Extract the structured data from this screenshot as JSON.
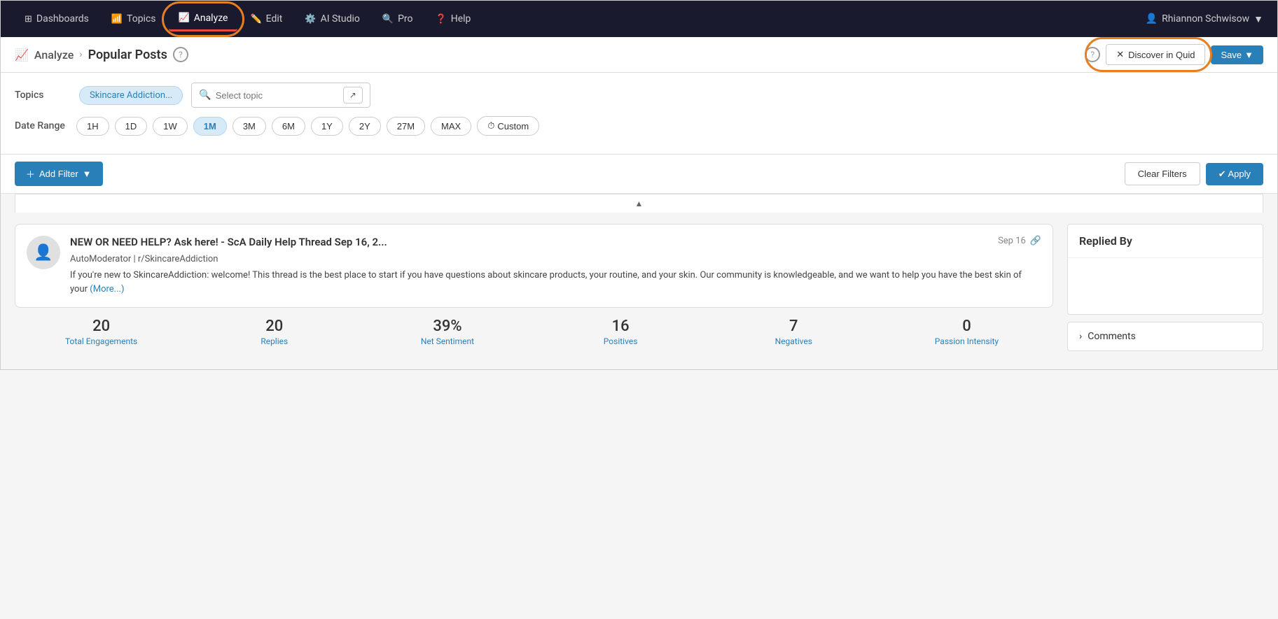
{
  "nav": {
    "items": [
      {
        "id": "dashboards",
        "label": "Dashboards",
        "icon": "⊞",
        "active": false
      },
      {
        "id": "topics",
        "label": "Topics",
        "icon": "📶",
        "active": false
      },
      {
        "id": "analyze",
        "label": "Analyze",
        "icon": "📈",
        "active": true
      },
      {
        "id": "edit",
        "label": "Edit",
        "icon": "✏️",
        "active": false
      },
      {
        "id": "ai-studio",
        "label": "AI Studio",
        "icon": "⚙️",
        "active": false
      },
      {
        "id": "pro",
        "label": "Pro",
        "icon": "🔍",
        "active": false
      },
      {
        "id": "help",
        "label": "Help",
        "icon": "❓",
        "active": false
      }
    ],
    "user": "Rhiannon Schwisow"
  },
  "subheader": {
    "breadcrumb_icon": "📈",
    "breadcrumb_parent": "Analyze",
    "breadcrumb_current": "Popular Posts",
    "discover_btn_label": "Discover in Quid",
    "save_btn_label": "Save"
  },
  "filters": {
    "topics_label": "Topics",
    "topic_chip": "Skincare Addiction...",
    "topic_search_placeholder": "Select topic",
    "date_range_label": "Date Range",
    "date_buttons": [
      {
        "id": "1h",
        "label": "1H",
        "active": false
      },
      {
        "id": "1d",
        "label": "1D",
        "active": false
      },
      {
        "id": "1w",
        "label": "1W",
        "active": false
      },
      {
        "id": "1m",
        "label": "1M",
        "active": true
      },
      {
        "id": "3m",
        "label": "3M",
        "active": false
      },
      {
        "id": "6m",
        "label": "6M",
        "active": false
      },
      {
        "id": "1y",
        "label": "1Y",
        "active": false
      },
      {
        "id": "2y",
        "label": "2Y",
        "active": false
      },
      {
        "id": "27m",
        "label": "27M",
        "active": false
      },
      {
        "id": "max",
        "label": "MAX",
        "active": false
      },
      {
        "id": "custom",
        "label": "Custom",
        "active": false,
        "icon": "⏱"
      }
    ]
  },
  "actions": {
    "add_filter_label": "Add Filter",
    "clear_filters_label": "Clear Filters",
    "apply_label": "✔ Apply"
  },
  "post": {
    "title": "NEW OR NEED HELP? Ask here! - ScA Daily Help Thread Sep 16, 2...",
    "date": "Sep 16",
    "source": "AutoModerator | r/SkincareAddiction",
    "text": "If you're new to SkincareAddiction: welcome! This thread is the best place to start if you have questions about skincare products, your routine, and your skin. Our community is knowledgeable, and we want to help you have the best skin of your",
    "more_label": "(More...)",
    "stats": [
      {
        "id": "total-engagements",
        "value": "20",
        "label": "Total Engagements"
      },
      {
        "id": "replies",
        "value": "20",
        "label": "Replies"
      },
      {
        "id": "net-sentiment",
        "value": "39%",
        "label": "Net Sentiment"
      },
      {
        "id": "positives",
        "value": "16",
        "label": "Positives"
      },
      {
        "id": "negatives",
        "value": "7",
        "label": "Negatives"
      },
      {
        "id": "passion-intensity",
        "value": "0",
        "label": "Passion Intensity"
      }
    ]
  },
  "side_panel": {
    "replied_by_title": "Replied By",
    "comments_label": "Comments"
  }
}
